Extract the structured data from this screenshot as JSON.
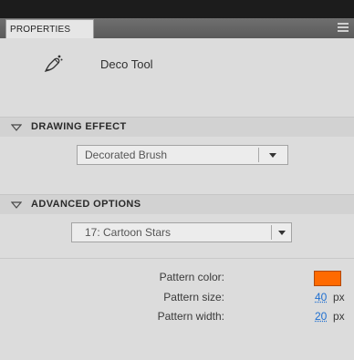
{
  "panel": {
    "tab_label": "PROPERTIES"
  },
  "tool": {
    "name": "Deco Tool",
    "icon": "deco-brush-icon"
  },
  "drawing_effect": {
    "title": "DRAWING EFFECT",
    "selected": "Decorated Brush"
  },
  "advanced_options": {
    "title": "ADVANCED OPTIONS",
    "selected": "17: Cartoon Stars"
  },
  "properties": {
    "pattern_color_label": "Pattern color:",
    "pattern_color": "#ff6a00",
    "pattern_size_label": "Pattern size:",
    "pattern_size_value": "40",
    "pattern_width_label": "Pattern width:",
    "pattern_width_value": "20",
    "unit": "px"
  }
}
